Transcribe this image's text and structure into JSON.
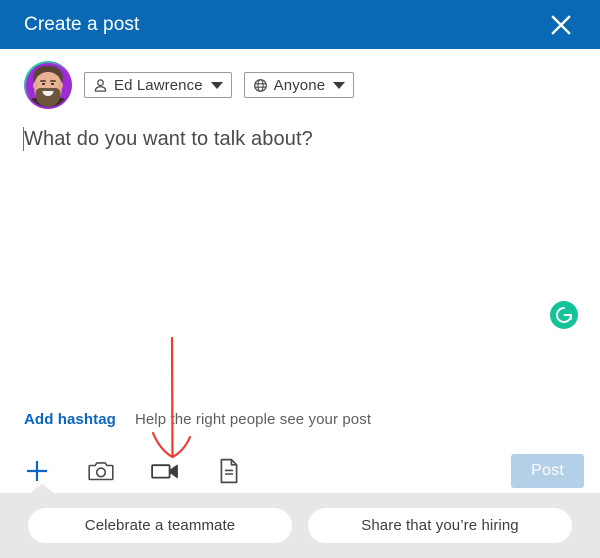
{
  "header": {
    "title": "Create a post",
    "close_icon": "close-icon",
    "background_color": "#0a69b4",
    "title_color": "#ffffff"
  },
  "identity": {
    "avatar_alt": "Ed Lawrence profile photo",
    "author_chip": {
      "icon": "person-icon",
      "label": "Ed Lawrence",
      "caret_icon": "chevron-down-icon"
    },
    "audience_chip": {
      "icon": "globe-icon",
      "label": "Anyone",
      "caret_icon": "chevron-down-icon"
    }
  },
  "editor": {
    "placeholder": "What do you want to talk about?",
    "value": "",
    "grammarly": {
      "icon": "grammarly-icon",
      "label": "G",
      "color": "#15c39a"
    }
  },
  "hashtag": {
    "link_label": "Add hashtag",
    "link_color": "#0a66c2",
    "hint": "Help the right people see your post"
  },
  "toolbar": {
    "items": [
      {
        "icon": "plus-icon",
        "name": "add-content-button",
        "color": "#0a66c2"
      },
      {
        "icon": "camera-icon",
        "name": "add-photo-button",
        "color": "#4a4a4a"
      },
      {
        "icon": "video-icon",
        "name": "add-video-button",
        "color": "#3d3d3d"
      },
      {
        "icon": "document-icon",
        "name": "add-document-button",
        "color": "#4a4a4a"
      }
    ],
    "post_label": "Post",
    "post_enabled": false,
    "post_color": "#b3d0e8"
  },
  "footer": {
    "suggestions": [
      {
        "label": "Celebrate a teammate"
      },
      {
        "label": "Share that you’re hiring"
      }
    ],
    "background_color": "#e7e7e7"
  },
  "annotation": {
    "type": "arrow",
    "color": "#ee3b33",
    "points_to": "add-video-button",
    "description": "Red hand-drawn arrow pointing down to the video icon"
  }
}
